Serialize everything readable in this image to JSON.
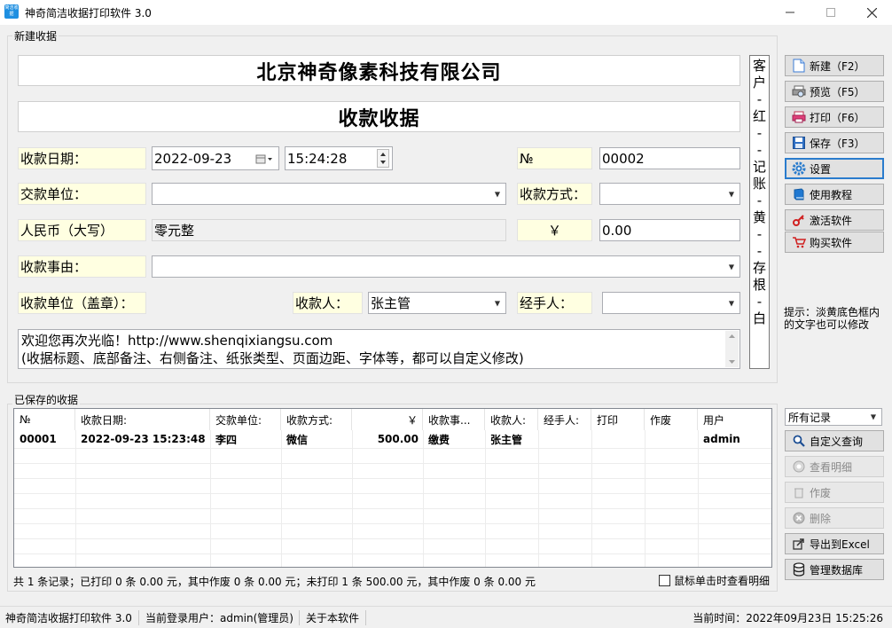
{
  "window": {
    "title": "神奇简洁收据打印软件 3.0",
    "icon_text": "简洁收据",
    "min_icon": "minimize-icon",
    "max_icon": "maximize-icon",
    "close_icon": "close-icon"
  },
  "new_receipt": {
    "group_label": "新建收据",
    "company": "北京神奇像素科技有限公司",
    "doc_title": "收款收据",
    "date_label": "收款日期：",
    "date_value": "2022-09-23",
    "time_value": "15:24:28",
    "no_label": "№",
    "no_value": "00002",
    "payer_label": "交款单位：",
    "payer_value": "",
    "method_label": "收款方式：",
    "method_value": "",
    "rmb_upper_label": "人民币（大写）",
    "rmb_upper_value": "零元整",
    "yen_label": "￥",
    "amount_value": "0.00",
    "reason_label": "收款事由：",
    "reason_value": "",
    "stamp_label": "收款单位（盖章）：",
    "receiver_label": "收款人：",
    "receiver_value": "张主管",
    "handler_label": "经手人：",
    "handler_value": "",
    "note_line1": "欢迎您再次光临！http://www.shenqixiangsu.com",
    "note_line2": "(收据标题、底部备注、右侧备注、纸张类型、页面边距、字体等，都可以自定义修改)",
    "side_note": [
      "客",
      "户",
      "-",
      "红",
      "-",
      "-",
      "记",
      "账",
      "-",
      "黄",
      "-",
      "-",
      "存",
      "根",
      "-",
      "白"
    ]
  },
  "toolbar": {
    "new": "新建（F2）",
    "preview": "预览（F5）",
    "print": "打印（F6）",
    "save": "保存（F3）",
    "settings": "设置",
    "tutorial": "使用教程",
    "activate": "激活软件",
    "buy": "购买软件",
    "hint": "提示：淡黄底色框内的文字也可以修改"
  },
  "saved": {
    "group_label": "已保存的收据",
    "columns": [
      "№",
      "收款日期:",
      "交款单位:",
      "收款方式:",
      "￥",
      "收款事...",
      "收款人:",
      "经手人:",
      "打印",
      "作废",
      "用户"
    ],
    "rows": [
      {
        "no": "00001",
        "date": "2022-09-23 15:23:48",
        "payer": "李四",
        "method": "微信",
        "amount": "500.00",
        "reason": "缴费",
        "receiver": "张主管",
        "handler": "",
        "printed": "",
        "void": "",
        "user": "admin"
      }
    ],
    "summary": "共 1 条记录；已打印 0 条 0.00 元，其中作废 0 条 0.00 元；未打印 1 条 500.00 元，其中作废 0 条 0.00 元",
    "click_detail_label": "鼠标单击时查看明细",
    "click_detail_checked": false
  },
  "right_panel": {
    "filter_value": "所有记录",
    "custom_query": "自定义查询",
    "view_detail": "查看明细",
    "void": "作废",
    "delete": "删除",
    "export": "导出到Excel",
    "manage_db": "管理数据库"
  },
  "statusbar": {
    "app": "神奇简洁收据打印软件 3.0",
    "user": "当前登录用户：admin(管理员)",
    "about": "关于本软件",
    "time": "当前时间：2022年09月23日 15:25:26"
  },
  "colors": {
    "label_bg": "#ffffe1",
    "accent": "#2a7ccd"
  }
}
